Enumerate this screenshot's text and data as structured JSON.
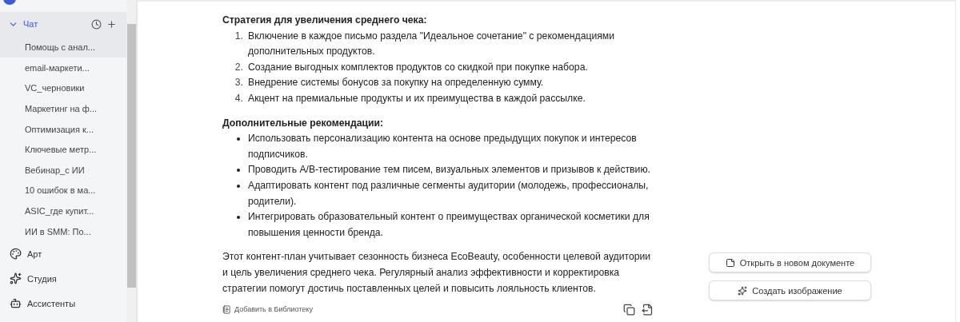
{
  "sidebar": {
    "chat_section": {
      "label": "Чат",
      "expanded": true,
      "items": [
        {
          "label": "Помощь с анал...",
          "selected": true
        },
        {
          "label": "email-маркети...",
          "selected": false
        },
        {
          "label": "VC_черновики",
          "selected": false
        },
        {
          "label": "Маркетинг на ф...",
          "selected": false
        },
        {
          "label": "Оптимизация к...",
          "selected": false
        },
        {
          "label": "Ключевые метр...",
          "selected": false
        },
        {
          "label": "Вебинар_с ИИ",
          "selected": false
        },
        {
          "label": "10 ошибок в ма...",
          "selected": false
        },
        {
          "label": "ASIC_где купит...",
          "selected": false
        },
        {
          "label": "ИИ в SMM: По...",
          "selected": false
        }
      ]
    },
    "nav": [
      {
        "label": "Арт",
        "kind": "art"
      },
      {
        "label": "Студия",
        "kind": "studio"
      },
      {
        "label": "Ассистенты",
        "kind": "assistants"
      }
    ]
  },
  "message": {
    "sections": [
      {
        "heading": "Стратегия для увеличения среднего чека:",
        "items": [
          {
            "number": "1.",
            "text": "Включение в каждое письмо раздела \"Идеальное сочетание\" с рекомендациями дополнительных продуктов."
          },
          {
            "number": "2.",
            "text": "Создание выгодных комплектов продуктов со скидкой при покупке набора."
          },
          {
            "number": "3.",
            "text": "Внедрение системы бонусов за покупку на определенную сумму."
          },
          {
            "number": "4.",
            "text": "Акцент на премиальные продукты и их преимущества в каждой рассылке."
          }
        ]
      },
      {
        "heading": "Дополнительные рекомендации:",
        "items": [
          {
            "text": "Использовать персонализацию контента на основе предыдущих покупок и интересов подписчиков."
          },
          {
            "text": "Проводить A/B-тестирование тем писем, визуальных элементов и призывов к действию."
          },
          {
            "text": "Адаптировать контент под различные сегменты аудитории (молодежь, профессионалы, родители)."
          },
          {
            "text": "Интегрировать образовательный контент о преимуществах органической косметики для повышения ценности бренда."
          }
        ]
      }
    ],
    "conclusion": "Этот контент-план учитывает сезонность бизнеса EcoBeauty, особенности целевой аудитории и цель увеличения среднего чека. Регулярный анализ эффективности и корректировка стратегии помогут достичь поставленных целей и повысить лояльность клиентов.",
    "add_to_library": "Добавить в Библиотеку"
  },
  "actions": [
    {
      "label": "Открыть в новом документе",
      "kind": "document"
    },
    {
      "label": "Создать изображение",
      "kind": "image"
    }
  ]
}
